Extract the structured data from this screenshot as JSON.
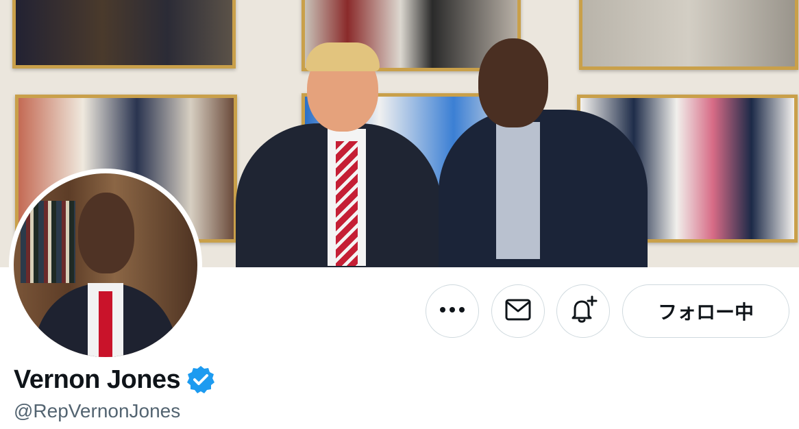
{
  "profile": {
    "display_name": "Vernon Jones",
    "handle": "@RepVernonJones",
    "verified": true
  },
  "actions": {
    "more_icon": "more-horizontal-icon",
    "message_icon": "envelope-icon",
    "notify_icon": "bell-plus-icon",
    "follow_label": "フォロー中"
  },
  "colors": {
    "verified_badge": "#1d9bf0",
    "text_primary": "#0f1419",
    "text_secondary": "#536471",
    "button_border": "#cfd9de"
  }
}
